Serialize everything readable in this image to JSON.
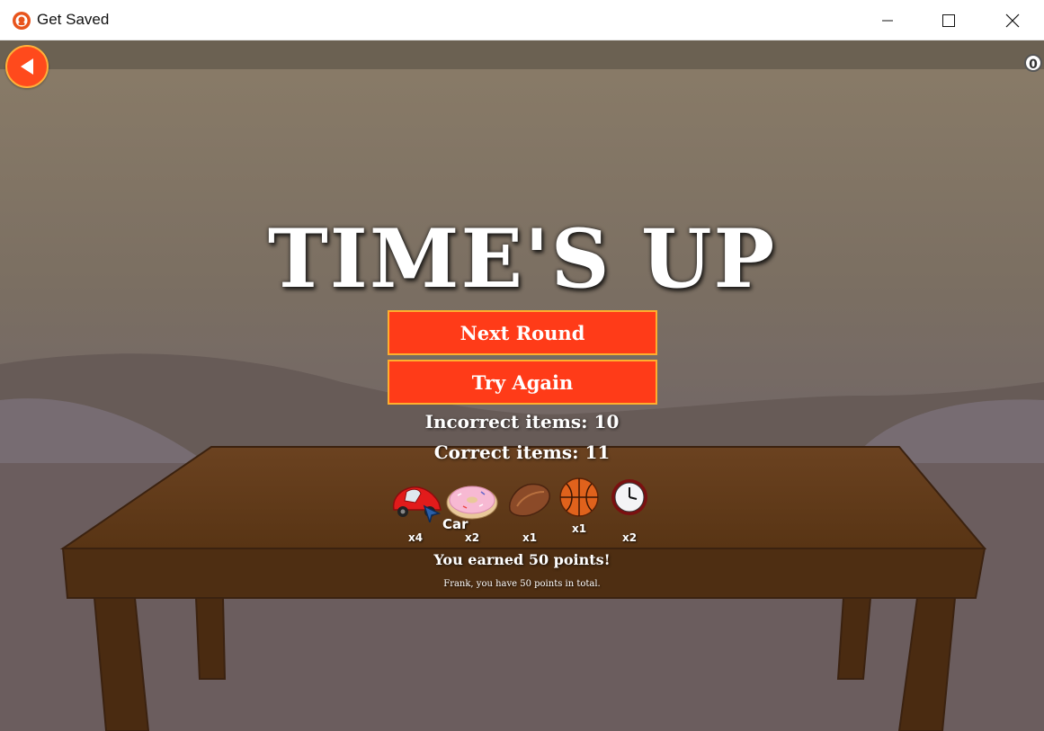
{
  "window": {
    "title": "Get Saved",
    "minimize_icon": "minimize-icon",
    "maximize_icon": "maximize-icon",
    "close_icon": "close-icon"
  },
  "game": {
    "counter": "0",
    "headline": "TIME'S UP",
    "buttons": {
      "next_round": "Next Round",
      "try_again": "Try Again"
    },
    "stats": {
      "incorrect": "Incorrect items: 10",
      "correct": "Correct items: 11"
    },
    "items": [
      {
        "name": "Car",
        "icon": "car-icon",
        "count": "x4"
      },
      {
        "name": "Donut",
        "icon": "donut-icon",
        "count": "x2"
      },
      {
        "name": "Bread",
        "icon": "bread-icon",
        "count": "x1"
      },
      {
        "name": "Basketball",
        "icon": "basketball-icon",
        "count": "x1"
      },
      {
        "name": "Clock",
        "icon": "clock-icon",
        "count": "x2"
      }
    ],
    "tooltip": "Car",
    "earned": "You earned 50 points!",
    "total": "Frank, you have 50 points in total."
  },
  "colors": {
    "button": "#ff3b18",
    "button_border": "#ffae2e",
    "back_button": "#ff4a1c",
    "table": "#5c3618"
  }
}
